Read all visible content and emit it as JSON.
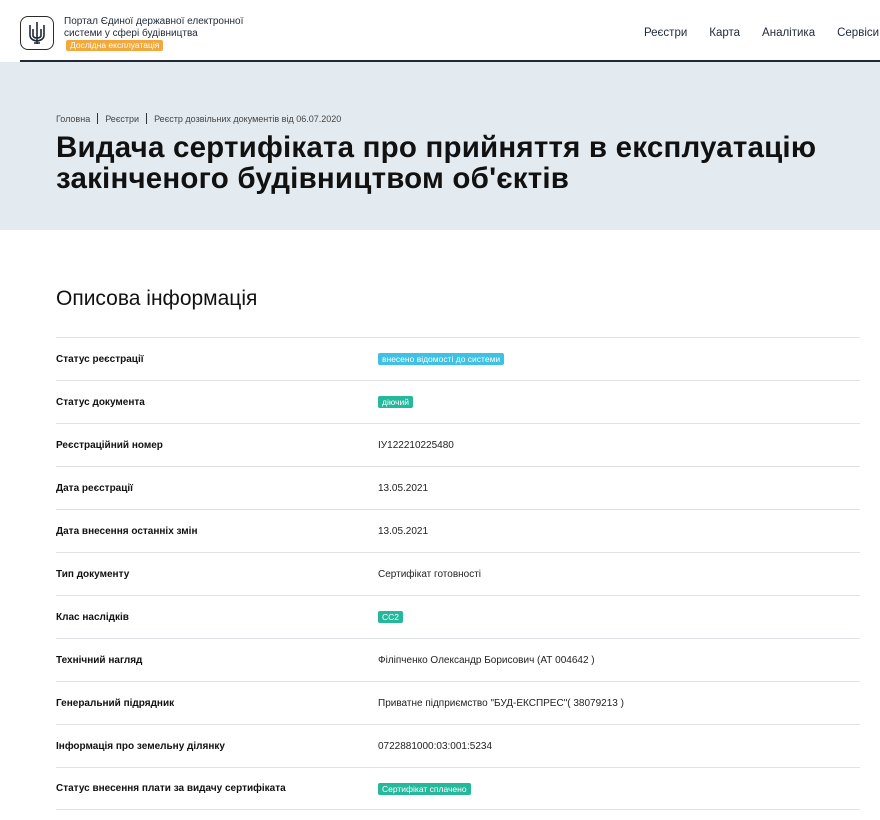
{
  "header": {
    "portal_title": "Портал Єдиної державної електронної системи у сфері будівництва",
    "pilot_badge": "Дослідна експлуатація",
    "nav": [
      "Реєстри",
      "Карта",
      "Аналітика",
      "Сервіси"
    ]
  },
  "hero": {
    "breadcrumb": [
      "Головна",
      "Реєстри",
      "Реєстр дозвільних документів від 06.07.2020"
    ],
    "title": "Видача сертифіката про прийняття в експлуатацію закінченого будівництвом об'єктів"
  },
  "section": {
    "title": "Описова інформація",
    "rows": [
      {
        "label": "Статус реєстрації",
        "value": "внесено відомості до системи",
        "type": "tag",
        "color": "#3ec1e2"
      },
      {
        "label": "Статус документа",
        "value": "діючий",
        "type": "tag",
        "color": "#25b89b"
      },
      {
        "label": "Реєстраційний номер",
        "value": "ІУ122210225480",
        "type": "text"
      },
      {
        "label": "Дата реєстрації",
        "value": "13.05.2021",
        "type": "text"
      },
      {
        "label": "Дата внесення останніх змін",
        "value": "13.05.2021",
        "type": "text"
      },
      {
        "label": "Тип документу",
        "value": "Сертифікат готовності",
        "type": "text"
      },
      {
        "label": "Клас наслідків",
        "value": "СС2",
        "type": "tag",
        "color": "#25b89b"
      },
      {
        "label": "Технічний нагляд",
        "value": "Філіпченко Олександр Борисович (АТ 004642 )",
        "type": "text"
      },
      {
        "label": "Генеральний підрядник",
        "value": "Приватне підприємство \"БУД-ЕКСПРЕС\"( 38079213 )",
        "type": "text"
      },
      {
        "label": "Інформація про земельну ділянку",
        "value": "0722881000:03:001:5234",
        "type": "text"
      },
      {
        "label": "Статус внесення плати за видачу сертифіката",
        "value": "Сертифікат сплачено",
        "type": "tag",
        "color": "#25b89b"
      }
    ]
  }
}
